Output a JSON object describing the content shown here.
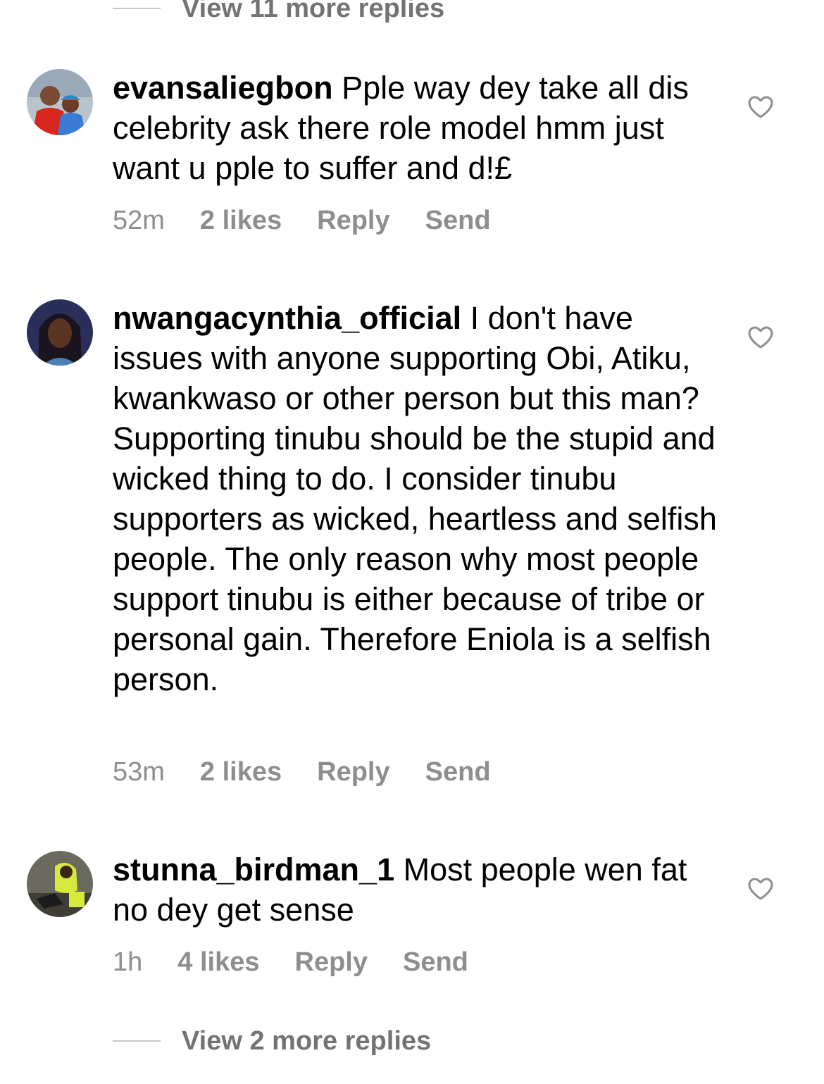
{
  "top_replies": {
    "label": "View 11 more replies"
  },
  "comments": [
    {
      "username": "evansaliegbon",
      "text": "Pple way dey take all dis celebrity ask there role model hmm just want u pple to suffer and d!£",
      "time": "52m",
      "likes": "2 likes",
      "reply": "Reply",
      "send": "Send"
    },
    {
      "username": "nwangacynthia_official",
      "text": "I don't have issues with anyone supporting Obi, Atiku, kwankwaso or other person but this man? Supporting tinubu should be the stupid and wicked thing to do. I consider tinubu supporters as wicked, heartless and selfish people.  The only reason why most people support tinubu is either because of tribe or personal gain. Therefore Eniola is a selfish person.",
      "time": "53m",
      "likes": "2 likes",
      "reply": "Reply",
      "send": "Send"
    },
    {
      "username": "stunna_birdman_1",
      "text": "Most people wen fat no dey get sense",
      "time": "1h",
      "likes": "4 likes",
      "reply": "Reply",
      "send": "Send"
    }
  ],
  "bottom_replies": {
    "label": "View 2 more replies"
  }
}
